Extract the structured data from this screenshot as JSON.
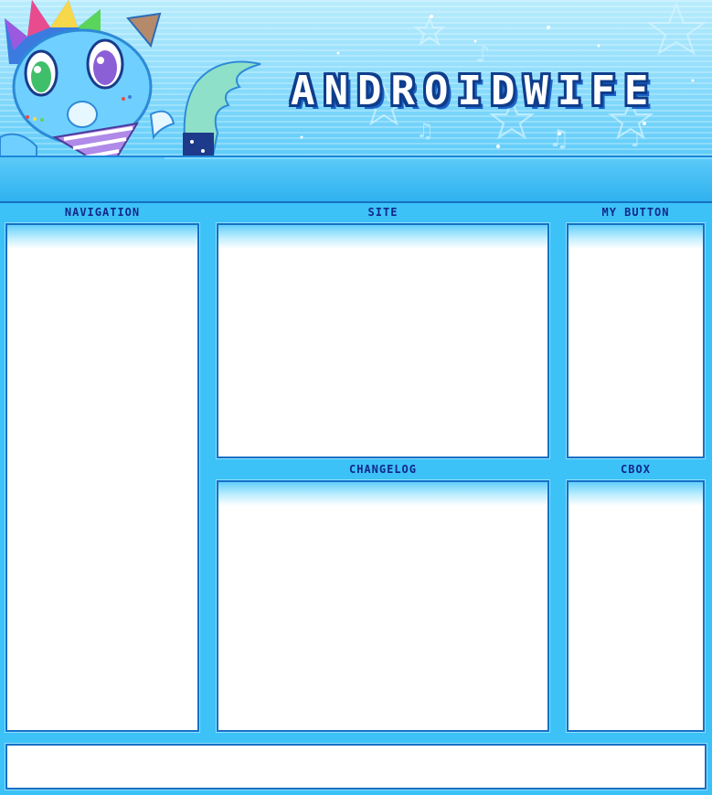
{
  "header": {
    "title": "ANDROIDWIFE"
  },
  "mascot": {
    "icon": "rainbow-haired-blue-cat-mascot-icon"
  },
  "panels": {
    "navigation": {
      "label": "NAVIGATION"
    },
    "site": {
      "label": "SITE"
    },
    "my_button": {
      "label": "MY BUTTON"
    },
    "changelog": {
      "label": "CHANGELOG"
    },
    "cbox": {
      "label": "CBOX"
    }
  },
  "colors": {
    "background": "#3cc2f7",
    "border": "#1570c7",
    "label_text": "#13288a",
    "title_outline": "#0f3d8c"
  }
}
